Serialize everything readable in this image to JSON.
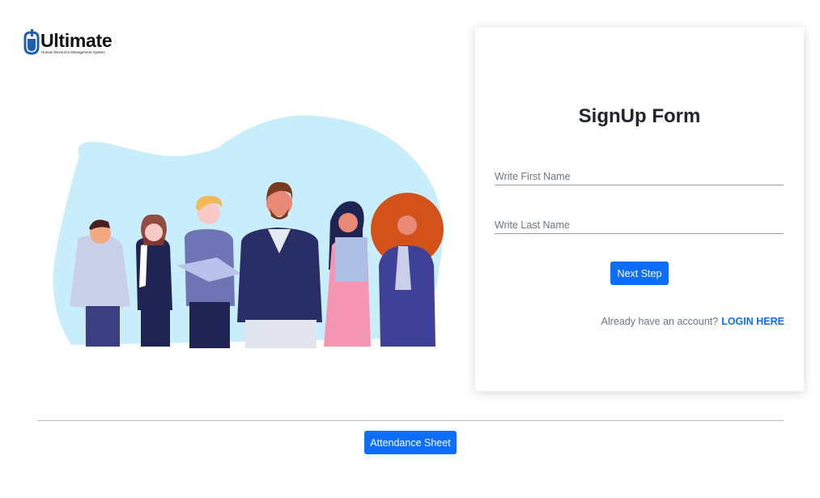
{
  "logo": {
    "name": "Ultimate",
    "tagline": "Human Resource Management System"
  },
  "form": {
    "title": "SignUp Form",
    "first_name_placeholder": "Write First Name",
    "last_name_placeholder": "Write Last Name",
    "next_button": "Next Step",
    "login_prompt": "Already have an account?",
    "login_link": "LOGIN HERE"
  },
  "footer": {
    "attendance_button": "Attendance Sheet"
  },
  "colors": {
    "primary": "#0d6efd",
    "blob": "#c8eefb",
    "logo_blue": "#1e5fb0"
  },
  "icons": {
    "logo": "mouse-logo-icon"
  }
}
